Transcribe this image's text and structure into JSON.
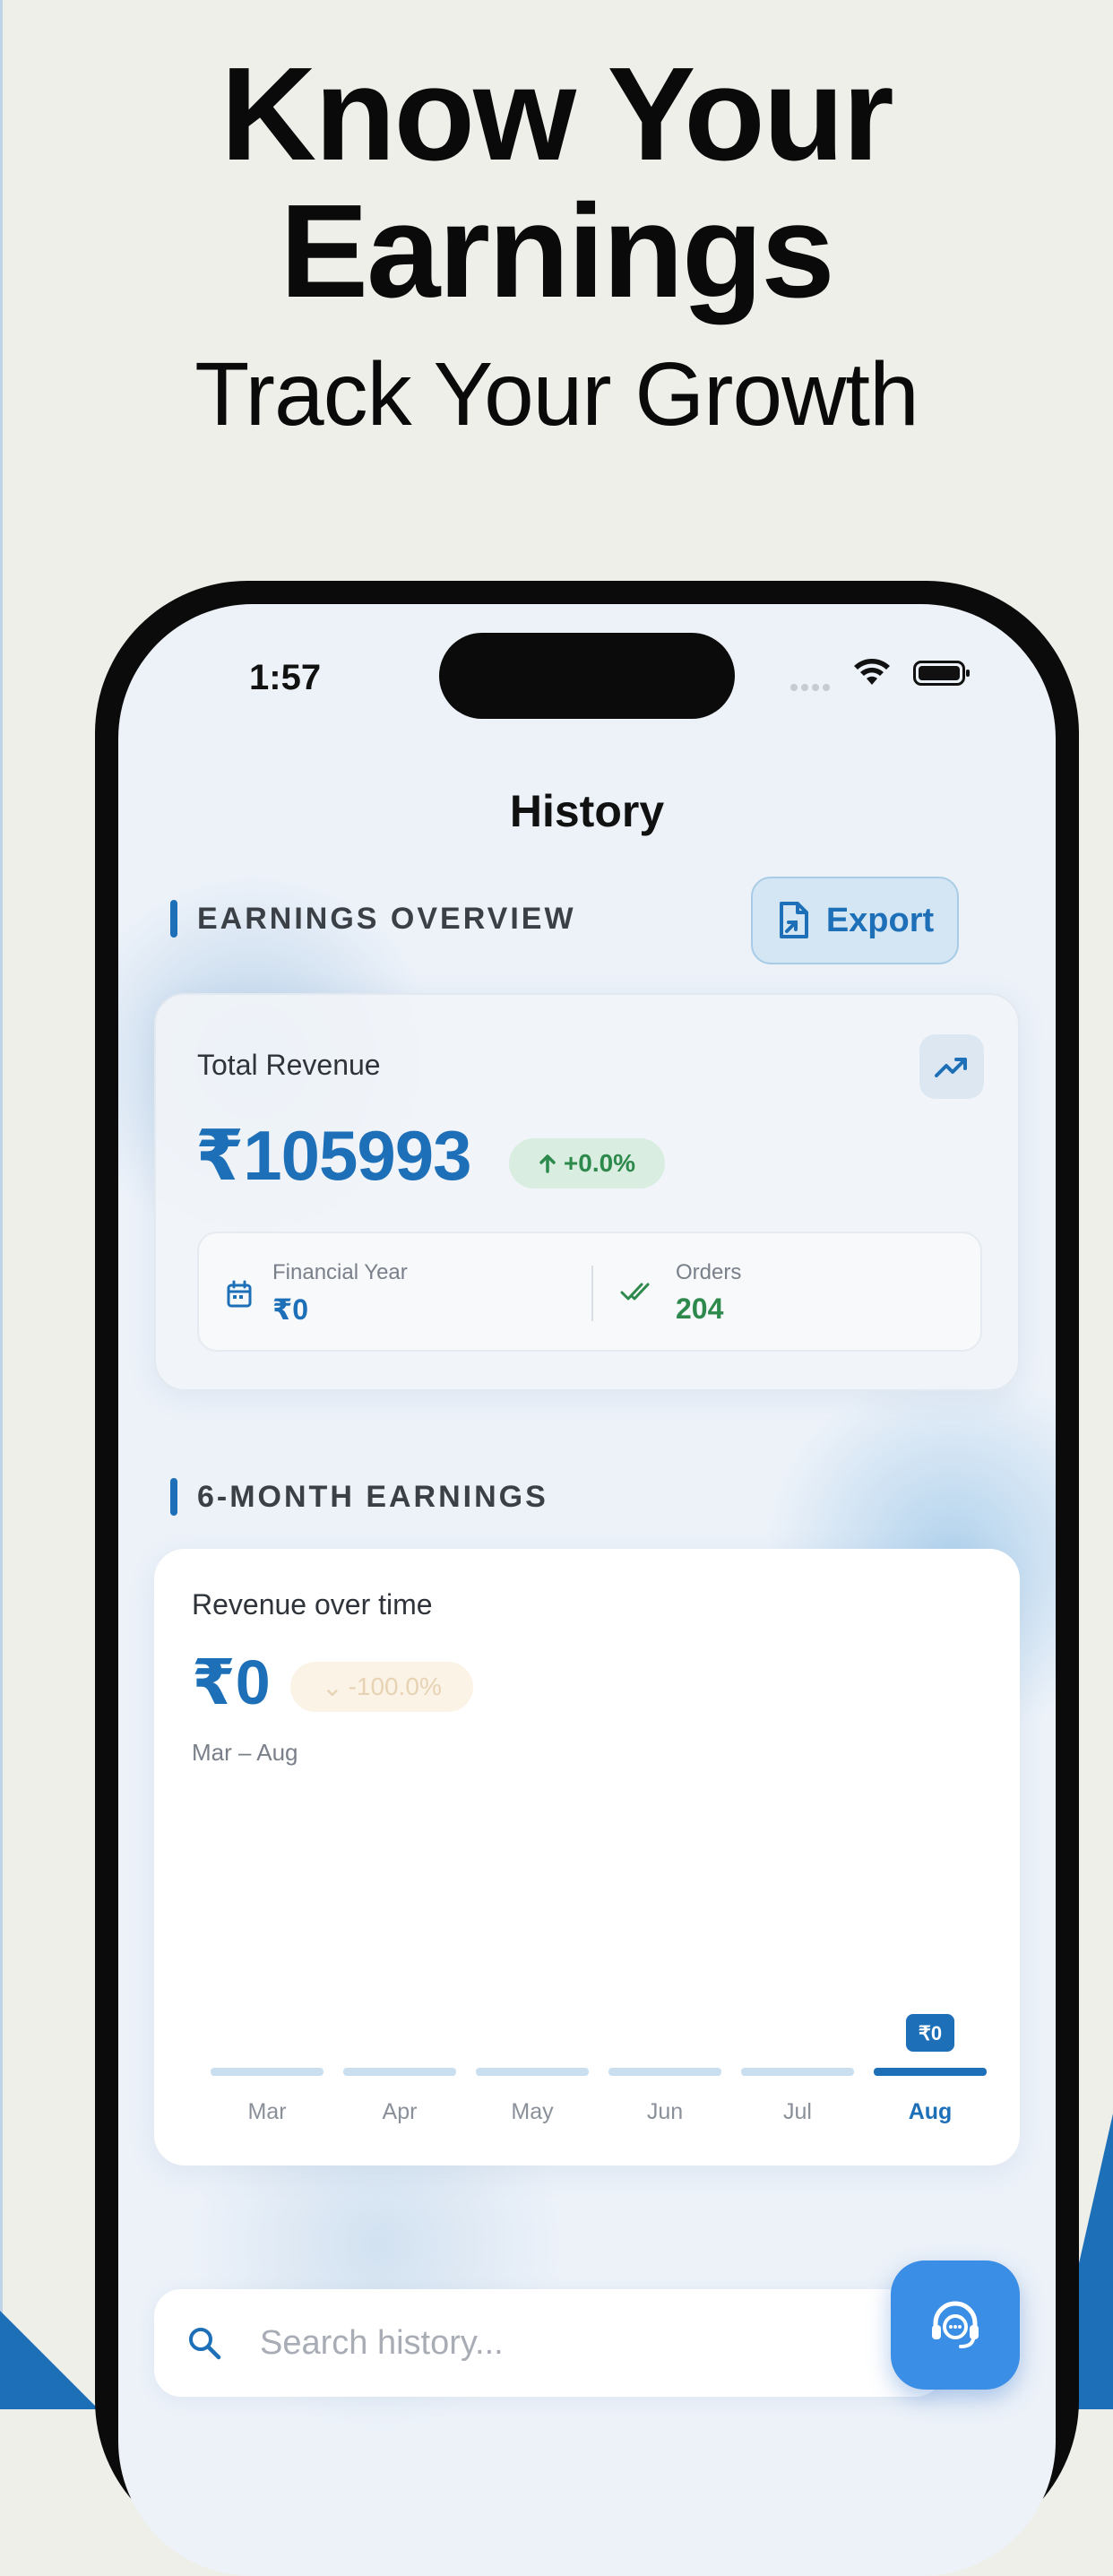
{
  "promo": {
    "headline_line1": "Know Your",
    "headline_line2": "Earnings",
    "subheadline": "Track Your Growth"
  },
  "status_bar": {
    "time": "1:57"
  },
  "nav": {
    "title": "History"
  },
  "earnings_overview": {
    "section_label": "EARNINGS OVERVIEW",
    "export_label": "Export",
    "card": {
      "label": "Total Revenue",
      "value": "₹105993",
      "change": "+0.0%",
      "financial_year": {
        "label": "Financial Year",
        "value": "₹0"
      },
      "orders": {
        "label": "Orders",
        "value": "204"
      }
    }
  },
  "six_month": {
    "section_label": "6-MONTH EARNINGS",
    "card": {
      "label": "Revenue over time",
      "value": "₹0",
      "change": "-100.0%",
      "range": "Mar – Aug"
    }
  },
  "chart_data": {
    "type": "bar",
    "categories": [
      "Mar",
      "Apr",
      "May",
      "Jun",
      "Jul",
      "Aug"
    ],
    "values": [
      0,
      0,
      0,
      0,
      0,
      0
    ],
    "selected_index": 5,
    "selected_label": "₹0",
    "title": "Revenue over time",
    "xlabel": "",
    "ylabel": "",
    "grid": false,
    "colors": {
      "bar": "#c9dff0",
      "selected": "#1d6fb8",
      "label": "#8a9099"
    }
  },
  "search": {
    "placeholder": "Search history..."
  },
  "colors": {
    "accent": "#1d6fb8",
    "positive": "#2e8a4c",
    "fab": "#3a8ee6"
  }
}
